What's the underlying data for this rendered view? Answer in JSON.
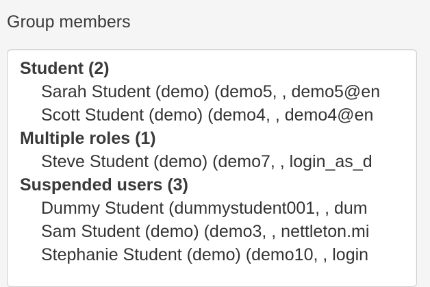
{
  "panel": {
    "label": "Group members"
  },
  "groups": [
    {
      "header": "Student (2)",
      "members": [
        "Sarah Student (demo) (demo5, , demo5@en",
        "Scott Student (demo) (demo4, , demo4@en"
      ]
    },
    {
      "header": "Multiple roles (1)",
      "members": [
        "Steve Student (demo) (demo7, , login_as_d"
      ]
    },
    {
      "header": "Suspended users (3)",
      "members": [
        "Dummy Student (dummystudent001, , dum",
        "Sam Student (demo) (demo3, , nettleton.mi",
        "Stephanie Student (demo) (demo10, , login"
      ]
    }
  ]
}
